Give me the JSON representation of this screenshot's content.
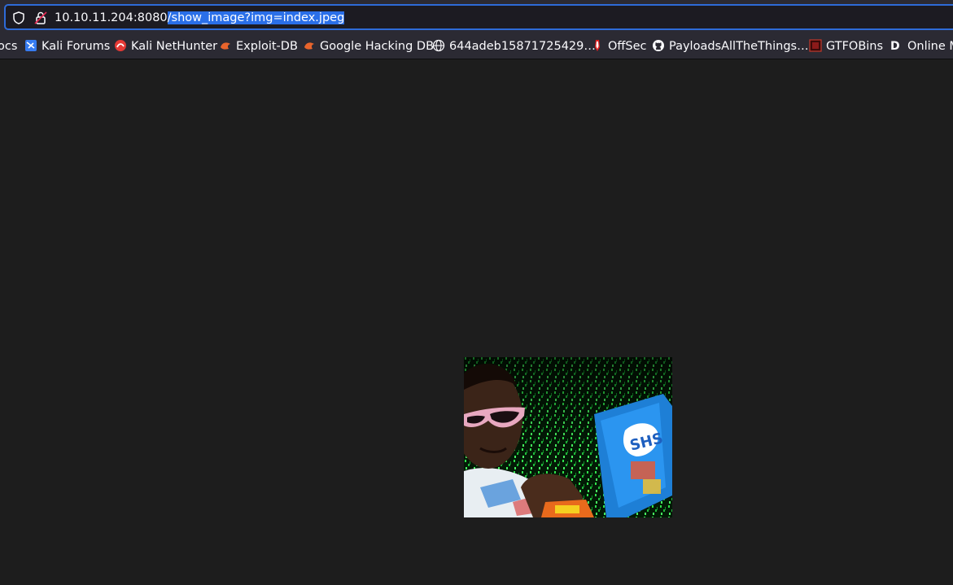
{
  "address_bar": {
    "host": "10.10.11.204:8080",
    "path_selected": "/show_image?img=index.jpeg"
  },
  "bookmarks": [
    {
      "label": "ocs",
      "icon": "kali-docs-icon"
    },
    {
      "label": "Kali Forums",
      "icon": "kali-forums-icon"
    },
    {
      "label": "Kali NetHunter",
      "icon": "kali-nethunter-icon"
    },
    {
      "label": "Exploit-DB",
      "icon": "exploit-db-icon"
    },
    {
      "label": "Google Hacking DB",
      "icon": "ghdb-icon"
    },
    {
      "label": "644adeb15871725429…",
      "icon": "globe-icon"
    },
    {
      "label": "OffSec",
      "icon": "offsec-icon"
    },
    {
      "label": "PayloadsAllTheThings…",
      "icon": "github-icon"
    },
    {
      "label": "GTFOBins",
      "icon": "gtfobins-icon"
    },
    {
      "label": "Online M",
      "icon": "d-letter-icon"
    }
  ],
  "content": {
    "image_alt": "index.jpeg"
  },
  "colors": {
    "selection": "#2a6fe8",
    "urlbar_focus_border": "#2e6bd8",
    "chrome_bg": "#2b2a33",
    "page_bg": "#1d1d1d"
  }
}
